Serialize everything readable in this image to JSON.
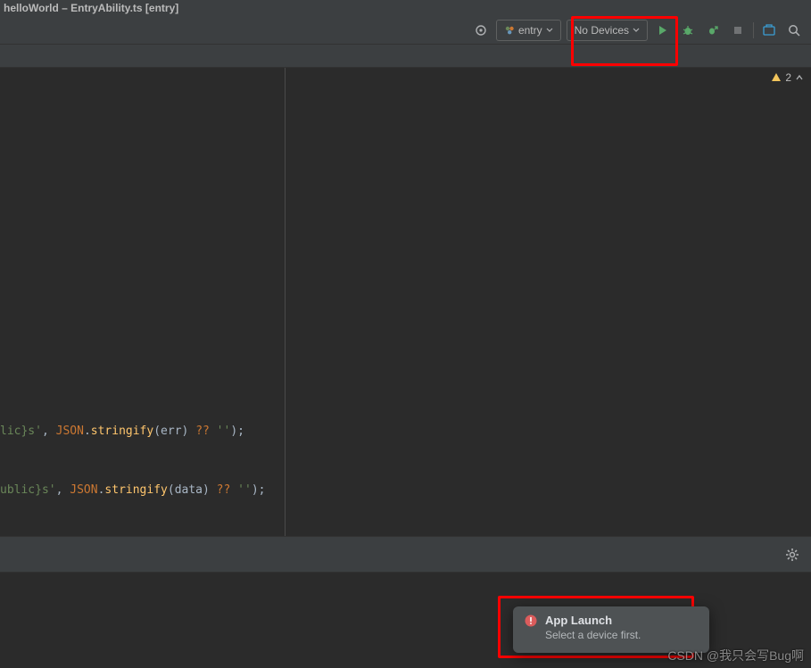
{
  "window": {
    "title": "helloWorld – EntryAbility.ts [entry]"
  },
  "toolbar": {
    "module_label": "entry",
    "device_label": "No Devices"
  },
  "warnings": {
    "count": "2"
  },
  "code": {
    "line1": {
      "pre": "lic}s'",
      "json": "JSON",
      "func": "stringify",
      "param": "err",
      "fallback": "''"
    },
    "line2": {
      "pre": "ublic}s'",
      "json": "JSON",
      "func": "stringify",
      "param": "data",
      "fallback": "''"
    }
  },
  "notification": {
    "title": "App Launch",
    "body": "Select a device first."
  },
  "watermark": "CSDN @我只会写Bug啊"
}
